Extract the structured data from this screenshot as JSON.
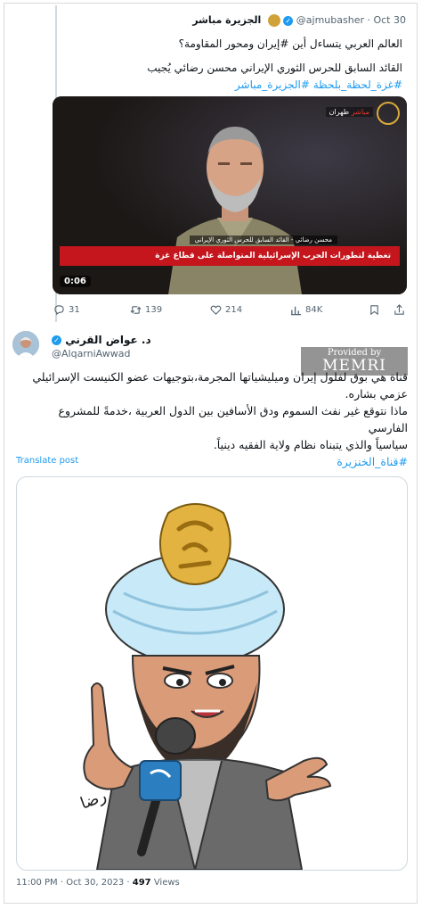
{
  "quoted_tweet": {
    "display_name": "الجزيرة مباشر",
    "handle": "@ajmubasher",
    "date": "· Oct 30",
    "line1": "العالم العربي يتساءل أين #إيران ومحور المقاومة؟",
    "line2": "القائد السابق للحرس الثوري الإيراني محسن رضائي يُجيب",
    "hashtags": "#غزة_لحظة_بلحظة #الجزيرة_مباشر",
    "video": {
      "corner_label": "مباشر",
      "corner_city": "طهران",
      "lower_third_small": "محسن رضائي - القائد السابق للحرس الثوري الإيراني",
      "lower_third_main": "تغطية لتطورات الحرب الإسرائيلية المتواصلة على قطاع غزة",
      "duration": "0:06"
    }
  },
  "actions": {
    "replies": "31",
    "reposts": "139",
    "likes": "214",
    "views": "84K"
  },
  "tweet": {
    "display_name": "د. عواض القرني",
    "handle": "@AlqarniAwwad",
    "text_line1": "قناة هي بوق لفلول إيران وميليشياتها المجرمة،بتوجيهات عضو الكنيست الإسرائيلي",
    "text_line2": "عزمي بشاره.",
    "text_line3": "ماذا نتوقع غير نفث السموم ودق الأسافين بين الدول العربية ،خدمةً للمشروع الفارسي",
    "text_line4": "سياسياً والذي يتبناه نظام ولاية الفقيه دينياً.",
    "hashtag": "#قناة_الخنزيرة",
    "translate_label": "Translate post",
    "cartoon_logo_text": "الجزيرة",
    "cartoon_signature": "رضا",
    "timestamp": "11:00 PM · Oct 30, 2023 ·",
    "views_count": "497",
    "views_label": "Views"
  },
  "watermark": {
    "provided_by": "Provided by",
    "brand": "MEMRI"
  },
  "colors": {
    "link": "#1d9bf0",
    "secondary": "#536471",
    "al_jazeera_red": "#c4161c",
    "turban": "#c8e9f7",
    "gold": "#d9a93b"
  }
}
